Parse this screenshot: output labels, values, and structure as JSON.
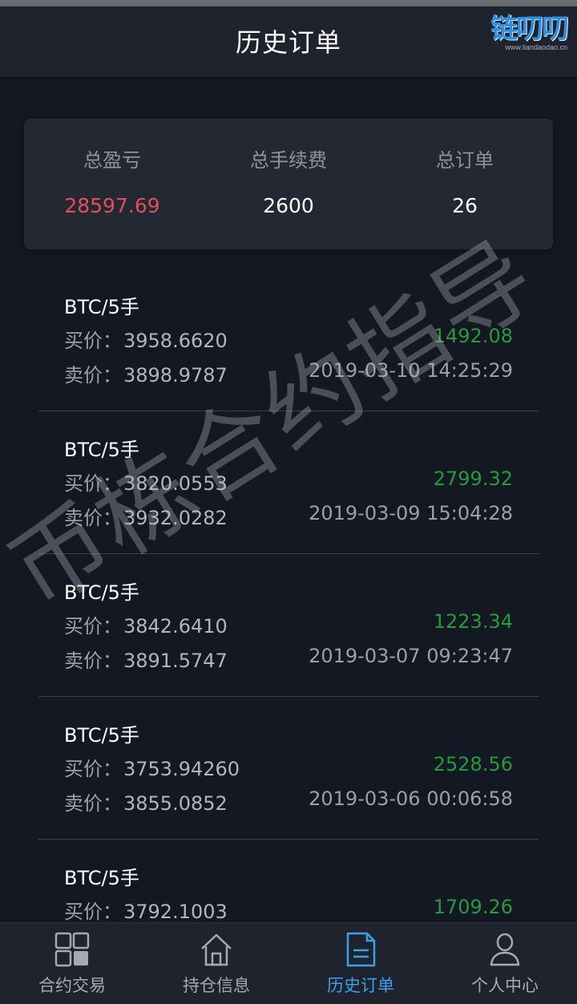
{
  "header": {
    "title": "历史订单",
    "brand": "链叨叨",
    "brand_url": "www.liandaodao.cn"
  },
  "summary": {
    "total_pnl_label": "总盈亏",
    "total_pnl_value": "28597.69",
    "total_fee_label": "总手续费",
    "total_fee_value": "2600",
    "total_orders_label": "总订单",
    "total_orders_value": "26"
  },
  "orders": [
    {
      "pair": "BTC/5手",
      "buy_label": "买价：",
      "buy_price": "3958.6620",
      "sell_label": "卖价：",
      "sell_price": "3898.9787",
      "pnl": "1492.08",
      "time": "2019-03-10 14:25:29"
    },
    {
      "pair": "BTC/5手",
      "buy_label": "买价：",
      "buy_price": "3820.0553",
      "sell_label": "卖价：",
      "sell_price": "3932.0282",
      "pnl": "2799.32",
      "time": "2019-03-09 15:04:28"
    },
    {
      "pair": "BTC/5手",
      "buy_label": "买价：",
      "buy_price": "3842.6410",
      "sell_label": "卖价：",
      "sell_price": "3891.5747",
      "pnl": "1223.34",
      "time": "2019-03-07 09:23:47"
    },
    {
      "pair": "BTC/5手",
      "buy_label": "买价：",
      "buy_price": "3753.94260",
      "sell_label": "卖价：",
      "sell_price": "3855.0852",
      "pnl": "2528.56",
      "time": "2019-03-06 00:06:58"
    },
    {
      "pair": "BTC/5手",
      "buy_label": "买价：",
      "buy_price": "3792.1003",
      "sell_label": "",
      "sell_price": "",
      "pnl": "1709.26",
      "time": ""
    }
  ],
  "watermark": "币栋合约指导",
  "tabs": [
    {
      "label": "合约交易",
      "icon": "grid-icon"
    },
    {
      "label": "持仓信息",
      "icon": "home-icon"
    },
    {
      "label": "历史订单",
      "icon": "document-icon"
    },
    {
      "label": "个人中心",
      "icon": "person-icon"
    }
  ],
  "colors": {
    "background": "#141823",
    "profit_red": "#e0505a",
    "profit_green": "#279a3b",
    "active_tab": "#3aa0ec"
  }
}
